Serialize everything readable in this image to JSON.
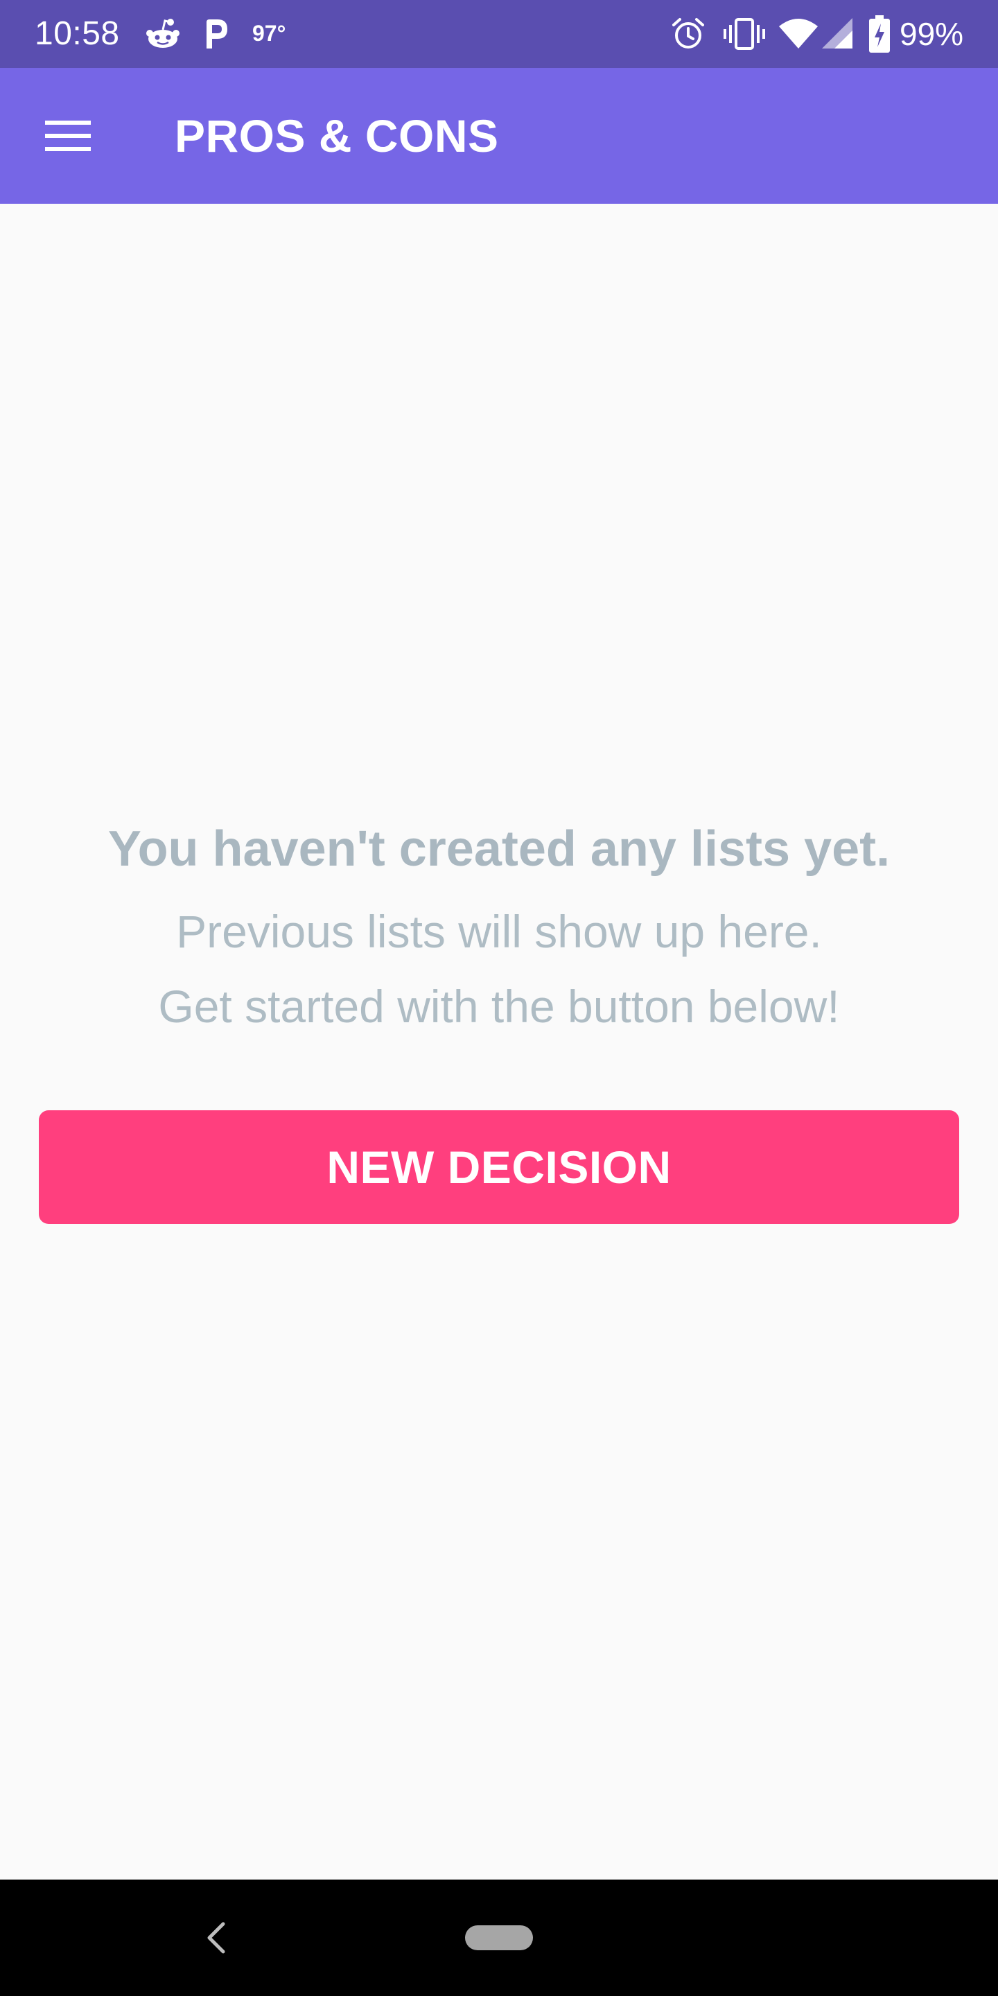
{
  "status_bar": {
    "time": "10:58",
    "temperature": "97°",
    "battery": "99%",
    "left_icons": [
      "reddit-icon",
      "parking-icon"
    ],
    "right_icons": [
      "alarm-icon",
      "vibrate-icon",
      "wifi-icon",
      "cell-signal-icon",
      "battery-charging-icon"
    ],
    "color": "#5a4eb0"
  },
  "app_bar": {
    "title": "PROS & CONS",
    "menu_icon": "menu-icon",
    "color": "#7666e6"
  },
  "empty_state": {
    "heading": "You haven't created any lists yet.",
    "line1": "Previous lists will show up here.",
    "line2": "Get started with the button below!",
    "text_color": "#a9b7c0"
  },
  "new_decision_button": {
    "label": "NEW DECISION",
    "color": "#ff3f7e"
  },
  "nav_bar": {
    "back_icon": "back-chevron-icon",
    "home_icon": "home-pill-icon"
  }
}
